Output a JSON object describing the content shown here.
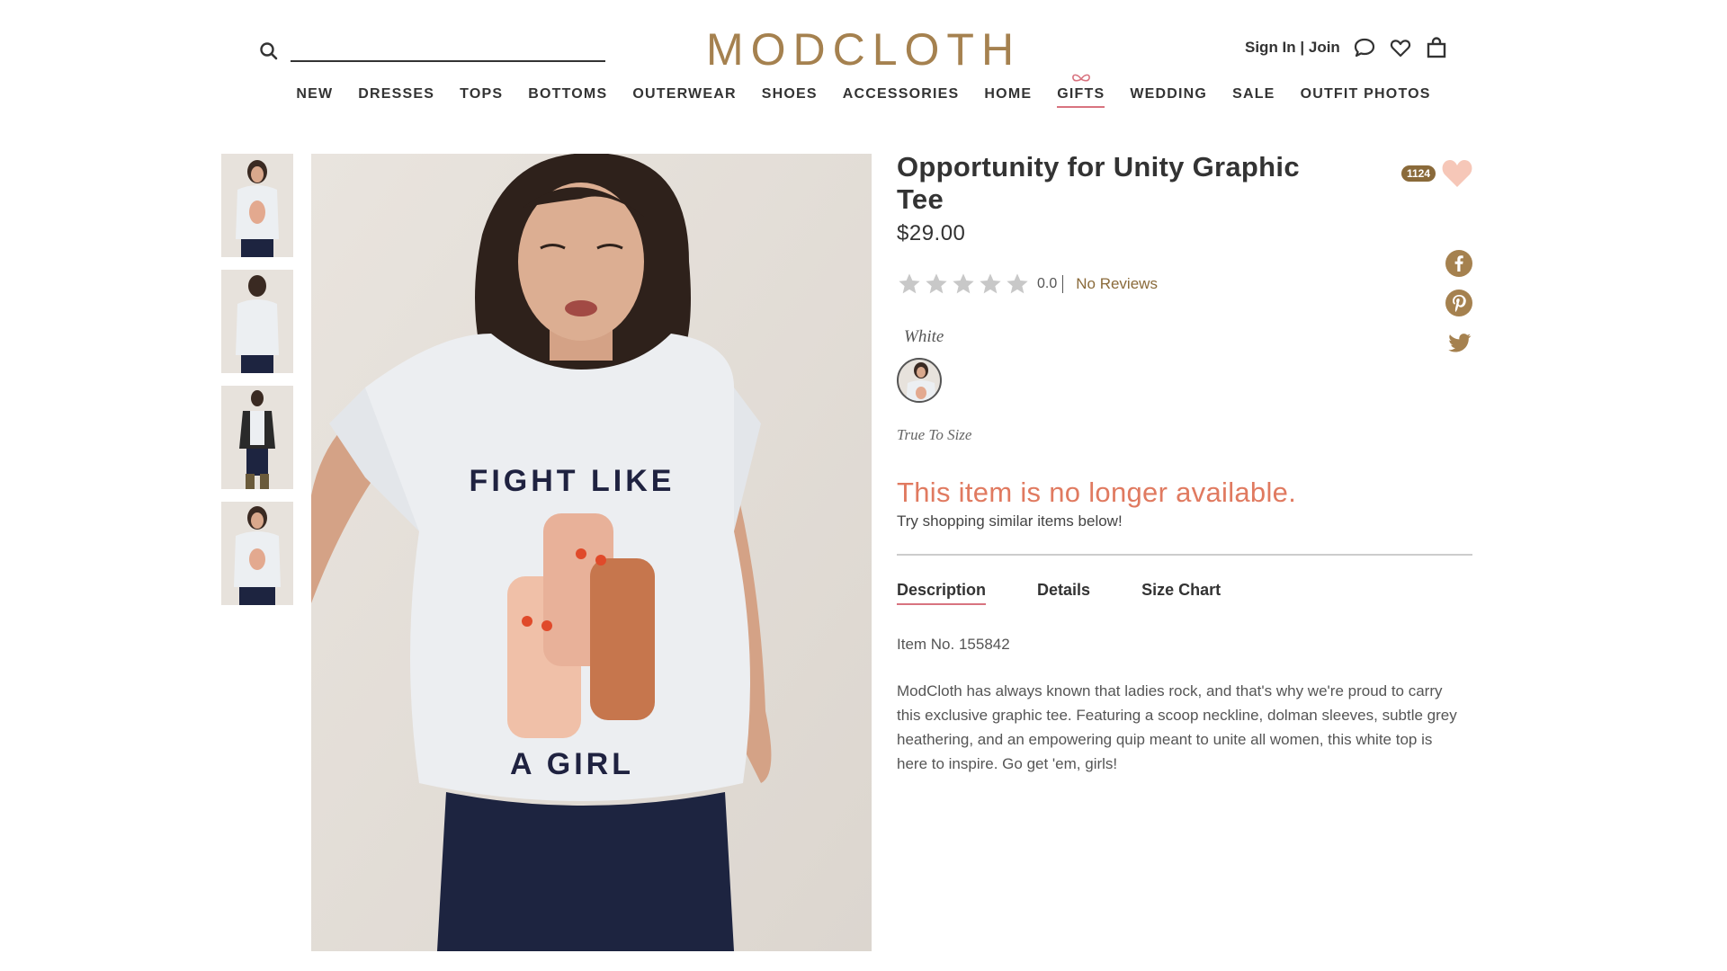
{
  "header": {
    "logo": "MODCLOTH",
    "search_placeholder": "",
    "signin_label": "Sign In | Join"
  },
  "nav": {
    "items": [
      "NEW",
      "DRESSES",
      "TOPS",
      "BOTTOMS",
      "OUTERWEAR",
      "SHOES",
      "ACCESSORIES",
      "HOME",
      "GIFTS",
      "WEDDING",
      "SALE",
      "OUTFIT PHOTOS"
    ]
  },
  "product": {
    "title": "Opportunity for Unity Graphic Tee",
    "price": "$29.00",
    "rating_value": "0.0",
    "rating_stars": 0,
    "reviews_label": "No Reviews",
    "color_label": "White",
    "fit_label": "True To Size",
    "unavailable_message": "This item is no longer available.",
    "try_similar": "Try shopping similar items below!",
    "wishlist_count": "1124",
    "tabs": [
      "Description",
      "Details",
      "Size Chart"
    ],
    "item_number": "Item No. 155842",
    "description": "ModCloth has always known that ladies rock, and that's why we're proud to carry this exclusive graphic tee. Featuring a scoop neckline, dolman sleeves, subtle grey heathering, and an empowering quip meant to unite all women, this white top is here to inspire. Go get 'em, girls!",
    "shirt_text_top": "FIGHT LIKE",
    "shirt_text_bottom": "A GIRL"
  },
  "social": [
    "facebook-icon",
    "pinterest-icon",
    "twitter-icon"
  ],
  "colors": {
    "brand_gold": "#a5814f",
    "accent_pink": "#d8737f",
    "unavailable_orange": "#e07a60",
    "heart_pink": "#f6c7b8"
  }
}
